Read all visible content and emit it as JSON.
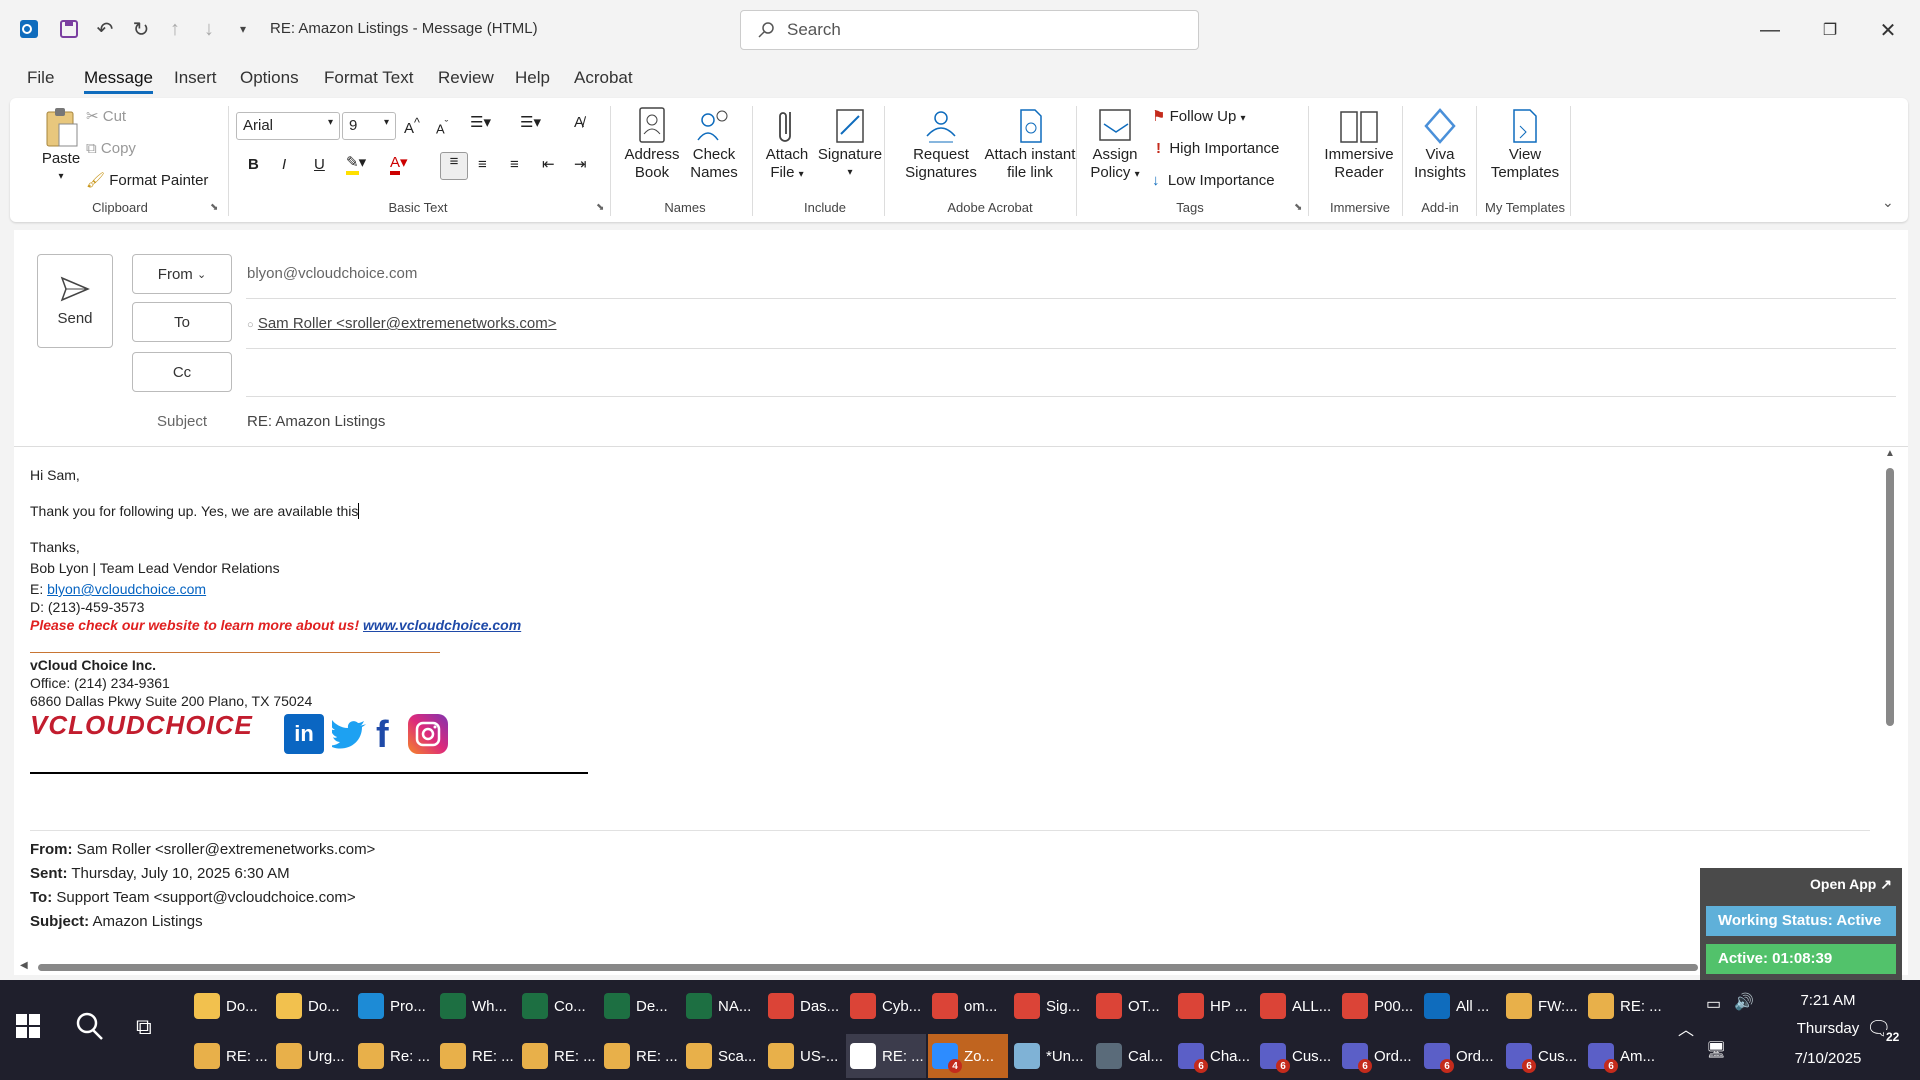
{
  "titlebar": {
    "title": "RE: Amazon Listings  -  Message (HTML)",
    "search_placeholder": "Search"
  },
  "tabs": [
    "File",
    "Message",
    "Insert",
    "Options",
    "Format Text",
    "Review",
    "Help",
    "Acrobat"
  ],
  "ribbon": {
    "clipboard": {
      "paste": "Paste",
      "cut": "Cut",
      "copy": "Copy",
      "format_painter": "Format Painter",
      "label": "Clipboard"
    },
    "basic_text": {
      "font": "Arial",
      "size": "9",
      "label": "Basic Text",
      "bold": "B",
      "italic": "I",
      "underline": "U"
    },
    "names": {
      "address_book_1": "Address",
      "address_book_2": "Book",
      "check_names_1": "Check",
      "check_names_2": "Names",
      "label": "Names"
    },
    "include": {
      "attach_1": "Attach",
      "attach_2": "File",
      "signature": "Signature",
      "label": "Include"
    },
    "adobe": {
      "request_1": "Request",
      "request_2": "Signatures",
      "attach_link_1": "Attach instant",
      "attach_link_2": "file link",
      "label": "Adobe Acrobat"
    },
    "tags": {
      "assign_1": "Assign",
      "assign_2": "Policy",
      "follow_up": "Follow Up",
      "high": "High Importance",
      "low": "Low Importance",
      "label": "Tags"
    },
    "immersive": {
      "btn_1": "Immersive",
      "btn_2": "Reader",
      "label": "Immersive"
    },
    "addin": {
      "btn_1": "Viva",
      "btn_2": "Insights",
      "label": "Add-in"
    },
    "templates": {
      "btn_1": "View",
      "btn_2": "Templates",
      "label": "My Templates"
    }
  },
  "compose": {
    "send": "Send",
    "from_label": "From",
    "from_value": "blyon@vcloudchoice.com",
    "to_label": "To",
    "to_value": "Sam Roller <sroller@extremenetworks.com>",
    "cc_label": "Cc",
    "subject_label": "Subject",
    "subject_value": "RE: Amazon Listings"
  },
  "body": {
    "greeting": "Hi Sam,",
    "message": "Thank you for following up. Yes, we are available this",
    "thanks": "Thanks,",
    "sig_name": "Bob Lyon | Team Lead Vendor Relations",
    "email_prefix": "E: ",
    "email": "blyon@vcloudchoice.com",
    "direct": "D: (213)-459-3573",
    "promo": "Please check our website to learn more about us!",
    "website": "www.vcloudchoice.com",
    "company": "vCloud Choice Inc.",
    "office": "Office: (214) 234-9361",
    "address": "6860 Dallas Pkwy Suite 200 Plano, TX 75024",
    "logo": "VCLOUDCHOICE",
    "from_hdr": "From:",
    "from_txt": " Sam Roller <sroller@extremenetworks.com>",
    "sent_hdr": "Sent:",
    "sent_txt": " Thursday, July 10, 2025 6:30 AM",
    "to_hdr": "To:",
    "to_txt": " Support Team <support@vcloudchoice.com>",
    "subj_hdr": "Subject:",
    "subj_txt": " Amazon Listings"
  },
  "widget": {
    "open_app": "Open App ↗",
    "status": "Working Status: Active",
    "active": "Active: 01:08:39"
  },
  "taskbar": {
    "row1": [
      {
        "label": "Do...",
        "icon": "folder-icon",
        "color": "#f2c14e"
      },
      {
        "label": "Do...",
        "icon": "folder-icon",
        "color": "#f2c14e"
      },
      {
        "label": "Pro...",
        "icon": "edge-icon",
        "color": "#1d8bd6"
      },
      {
        "label": "Wh...",
        "icon": "excel-icon",
        "color": "#1d6f42"
      },
      {
        "label": "Co...",
        "icon": "excel-icon",
        "color": "#1d6f42"
      },
      {
        "label": "De...",
        "icon": "excel-icon",
        "color": "#1d6f42"
      },
      {
        "label": "NA...",
        "icon": "excel-icon",
        "color": "#1d6f42"
      },
      {
        "label": "Das...",
        "icon": "chrome-icon",
        "color": "#db4437"
      },
      {
        "label": "Cyb...",
        "icon": "chrome-icon",
        "color": "#db4437"
      },
      {
        "label": "om...",
        "icon": "chrome-icon",
        "color": "#db4437"
      },
      {
        "label": "Sig...",
        "icon": "chrome-icon",
        "color": "#db4437"
      },
      {
        "label": "OT...",
        "icon": "chrome-icon",
        "color": "#db4437"
      },
      {
        "label": "HP ...",
        "icon": "chrome-icon",
        "color": "#db4437"
      },
      {
        "label": "ALL...",
        "icon": "chrome-icon",
        "color": "#db4437"
      },
      {
        "label": "P00...",
        "icon": "chrome-icon",
        "color": "#db4437"
      },
      {
        "label": "All ...",
        "icon": "outlook-icon",
        "color": "#0f6cbd"
      },
      {
        "label": "FW:...",
        "icon": "mail-icon",
        "color": "#e8b04a"
      },
      {
        "label": "RE: ...",
        "icon": "mail-icon",
        "color": "#e8b04a"
      }
    ],
    "row2": [
      {
        "label": "RE: ...",
        "icon": "mail-icon",
        "color": "#e8b04a"
      },
      {
        "label": "Urg...",
        "icon": "mail-icon",
        "color": "#e8b04a"
      },
      {
        "label": "Re: ...",
        "icon": "mail-icon",
        "color": "#e8b04a"
      },
      {
        "label": "RE: ...",
        "icon": "mail-icon",
        "color": "#e8b04a"
      },
      {
        "label": "RE: ...",
        "icon": "mail-icon",
        "color": "#e8b04a"
      },
      {
        "label": "RE: ...",
        "icon": "mail-icon",
        "color": "#e8b04a"
      },
      {
        "label": "Sca...",
        "icon": "mail-icon",
        "color": "#e8b04a"
      },
      {
        "label": "US-...",
        "icon": "mail-icon",
        "color": "#e8b04a"
      },
      {
        "label": "RE: ...",
        "icon": "mail-icon",
        "color": "#ffffff"
      },
      {
        "label": "Zo...",
        "icon": "zoom-icon",
        "color": "#2d8cff",
        "badge": "4"
      },
      {
        "label": "*Un...",
        "icon": "notepad-icon",
        "color": "#7fb2d6"
      },
      {
        "label": "Cal...",
        "icon": "calculator-icon",
        "color": "#5a6b7a"
      },
      {
        "label": "Cha...",
        "icon": "teams-icon",
        "color": "#5b5fc7",
        "badge": "6"
      },
      {
        "label": "Cus...",
        "icon": "teams-icon",
        "color": "#5b5fc7",
        "badge": "6"
      },
      {
        "label": "Ord...",
        "icon": "teams-icon",
        "color": "#5b5fc7",
        "badge": "6"
      },
      {
        "label": "Ord...",
        "icon": "teams-icon",
        "color": "#5b5fc7",
        "badge": "6"
      },
      {
        "label": "Cus...",
        "icon": "teams-icon",
        "color": "#5b5fc7",
        "badge": "6"
      },
      {
        "label": "Am...",
        "icon": "teams-icon",
        "color": "#5b5fc7",
        "badge": "6"
      }
    ],
    "time": "7:21 AM",
    "day": "Thursday",
    "date": "7/10/2025",
    "notifications": "22"
  }
}
